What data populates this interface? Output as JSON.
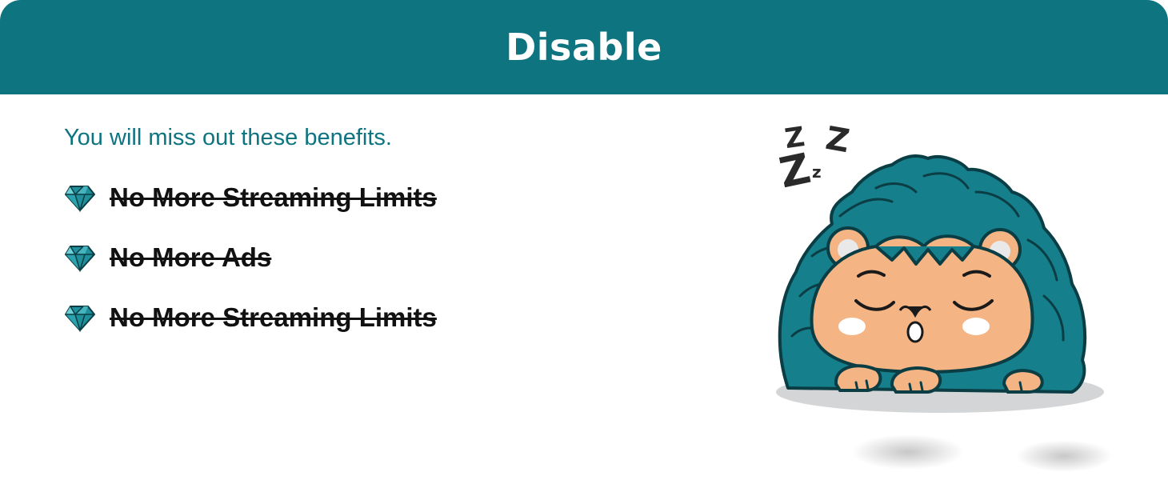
{
  "header": {
    "title": "Disable"
  },
  "subtitle": "You will miss out these benefits.",
  "benefits": [
    {
      "label": "No More Streaming Limits",
      "icon": "diamond-icon"
    },
    {
      "label": "No More Ads",
      "icon": "diamond-icon"
    },
    {
      "label": "No More Streaming Limits",
      "icon": "diamond-icon"
    }
  ],
  "mascot": {
    "icon": "sleeping-hedgehog-illustration",
    "sleep_letters": [
      "Z",
      "Z",
      "Z",
      "z"
    ]
  },
  "colors": {
    "accent": "#0e7480",
    "text": "#111111",
    "skin": "#f5b483",
    "spikes": "#157f8c"
  }
}
